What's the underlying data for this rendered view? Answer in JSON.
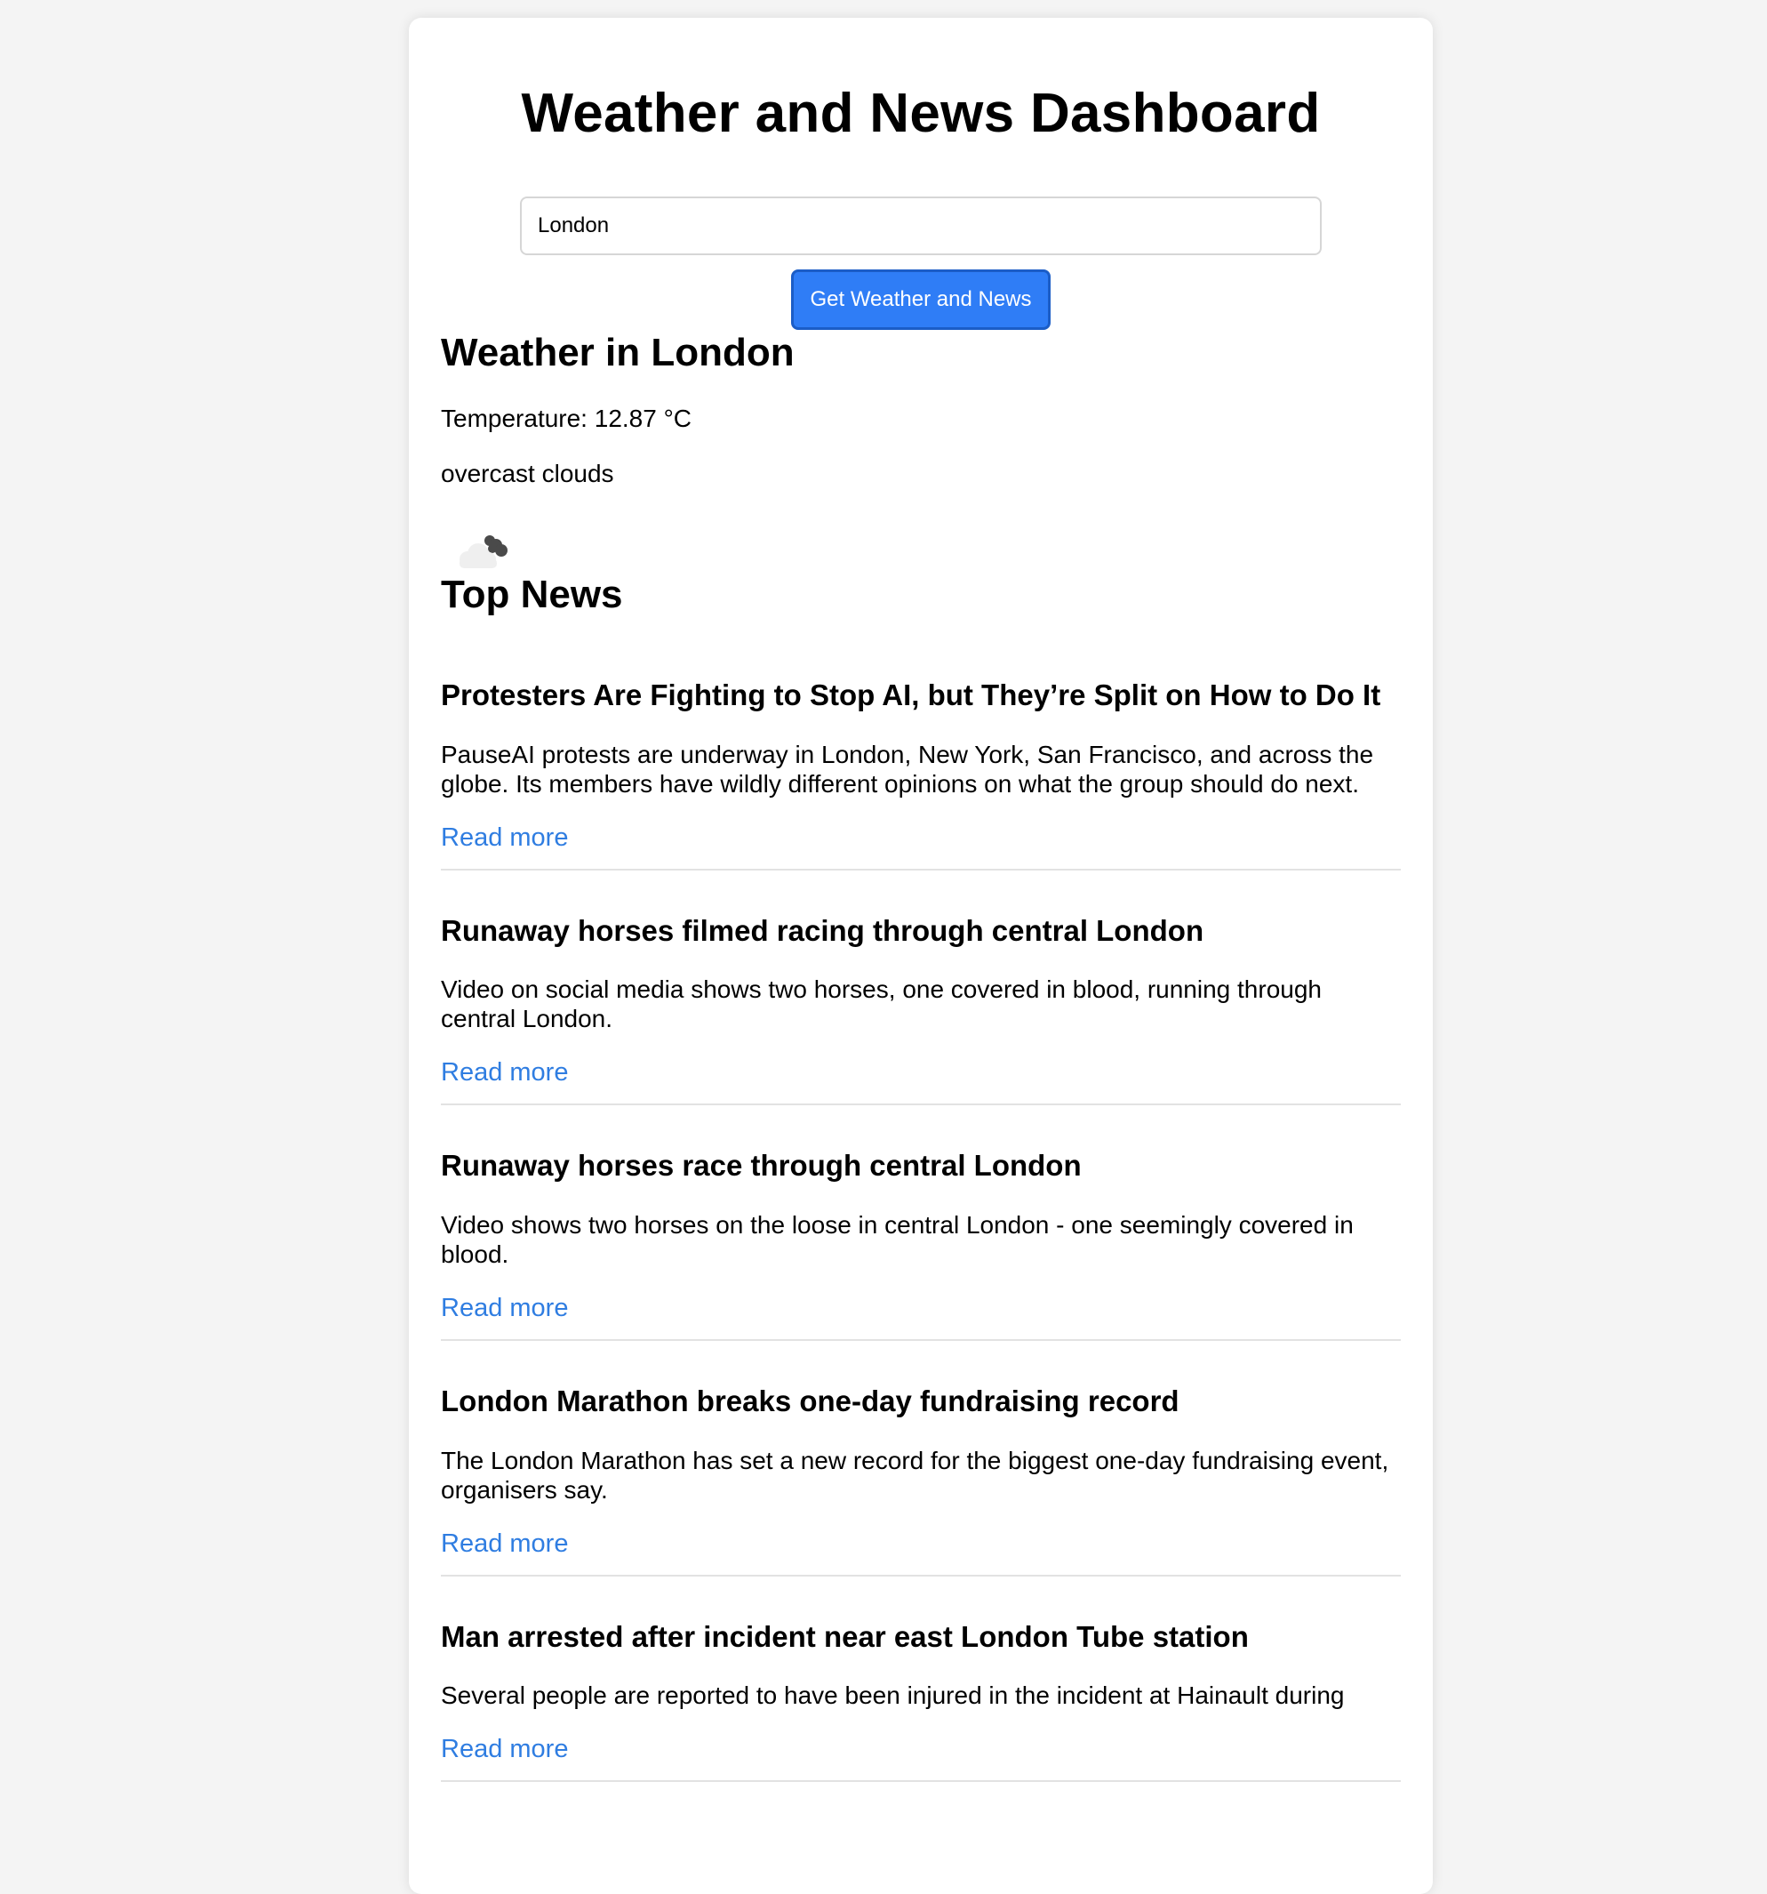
{
  "page": {
    "title": "Weather and News Dashboard"
  },
  "search": {
    "value": "London",
    "button_label": "Get Weather and News"
  },
  "weather": {
    "heading": "Weather in London",
    "temperature": "Temperature: 12.87 °C",
    "description": "overcast clouds",
    "icon": "overcast-clouds-icon"
  },
  "news": {
    "heading": "Top News",
    "read_more_label": "Read more",
    "items": [
      {
        "title": "Protesters Are Fighting to Stop AI, but They’re Split on How to Do It",
        "description": "PauseAI protests are underway in London, New York, San Francisco, and across the globe. Its members have wildly different opinions on what the group should do next.",
        "link_label": "Read more"
      },
      {
        "title": "Runaway horses filmed racing through central London",
        "description": "Video on social media shows two horses, one covered in blood, running through central London.",
        "link_label": "Read more"
      },
      {
        "title": "Runaway horses race through central London",
        "description": "Video shows two horses on the loose in central London - one seemingly covered in blood.",
        "link_label": "Read more"
      },
      {
        "title": "London Marathon breaks one-day fundraising record",
        "description": "The London Marathon has set a new record for the biggest one-day fundraising event, organisers say.",
        "link_label": "Read more"
      },
      {
        "title": "Man arrested after incident near east London Tube station",
        "description": "Several people are reported to have been injured in the incident at Hainault during",
        "link_label": "Read more"
      }
    ]
  },
  "colors": {
    "page_background": "#f4f4f4",
    "card_background": "#ffffff",
    "button_background": "#2f7df6",
    "button_border": "#1b5dc7",
    "link": "#2f7de1",
    "divider": "#e2e2e2"
  }
}
